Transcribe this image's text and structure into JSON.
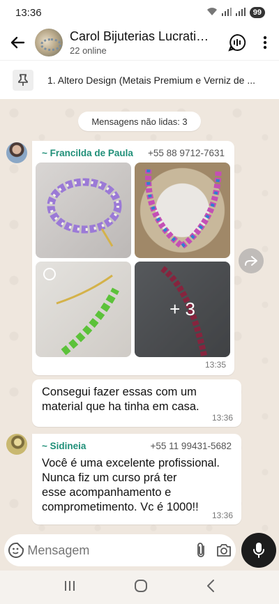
{
  "status_bar": {
    "time": "13:36",
    "battery": "99"
  },
  "header": {
    "title": "Carol Bijuterias Lucrativ...",
    "subtitle": "22 online"
  },
  "pinned": {
    "text": "1. Altero Design (Metais Premium e Verniz de ..."
  },
  "chat": {
    "unread_label": "Mensagens não lidas: 3",
    "media_message": {
      "sender": "~ Francilda de Paula",
      "phone": "+55 88 9712-7631",
      "more_count": "+ 3",
      "time": "13:35"
    },
    "text_message_1": {
      "text": "Consegui fazer essas com um\nmaterial  que ha tinha em casa.",
      "time": "13:36"
    },
    "text_message_2": {
      "sender": "~ Sidineia",
      "phone": "+55 11 99431-5682",
      "text": "Você é uma excelente profissional.\nNunca fiz um curso prá ter\nesse acompanhamento e\ncomprometimento.  Vc é 1000!!",
      "time": "13:36"
    }
  },
  "composer": {
    "placeholder": "Mensagem"
  },
  "colors": {
    "sender_name": "#1f8f78",
    "background": "#efe7de",
    "mic_button": "#1c1c1c"
  }
}
